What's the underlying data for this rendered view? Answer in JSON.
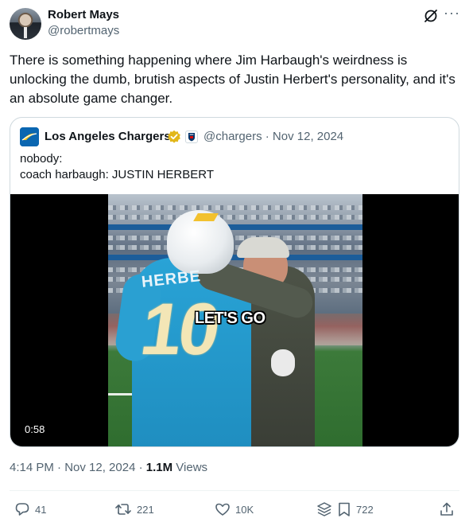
{
  "author": {
    "name": "Robert Mays",
    "handle": "@robertmays"
  },
  "tweet_text": "There is something happening where Jim Harbaugh's weirdness is unlocking the dumb, brutish aspects of Justin Herbert's personality, and it's an absolute game changer.",
  "header_icons": [
    "grok-icon",
    "more-icon"
  ],
  "more_label": "···",
  "quote": {
    "name": "Los Angeles Chargers",
    "handle_date": "@chargers · Nov 12, 2024",
    "text": "nobody:\ncoach harbaugh: JUSTIN HERBERT",
    "video": {
      "caption": "LET'S GO",
      "duration": "0:58",
      "jersey_number": "10",
      "jersey_name": "HERBE"
    }
  },
  "meta": {
    "time_date": "4:14 PM · Nov 12, 2024 · ",
    "views_count": "1.1M",
    "views_label": " Views"
  },
  "actions": {
    "replies": "41",
    "reposts": "221",
    "likes": "10K",
    "bookmarks": "722"
  },
  "colors": {
    "text": "#0f1419",
    "secondary": "#536471",
    "border": "#cfd9de",
    "verified_gold": "#e2b719",
    "chargers_blue": "#0a66b1"
  }
}
